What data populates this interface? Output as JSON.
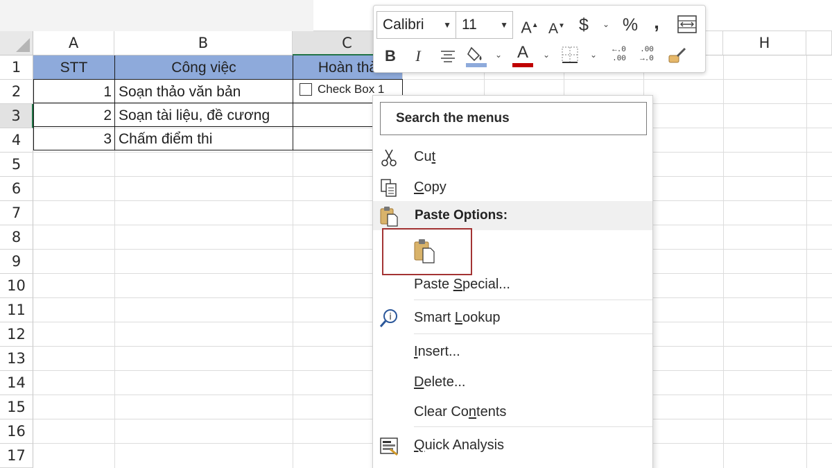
{
  "columns": [
    "A",
    "B",
    "C",
    "H"
  ],
  "rows": [
    "1",
    "2",
    "3",
    "4",
    "5",
    "6",
    "7",
    "8",
    "9",
    "10",
    "11",
    "12",
    "13",
    "14",
    "15",
    "16",
    "17"
  ],
  "table": {
    "headers": [
      "STT",
      "Công việc",
      "Hoàn thà"
    ],
    "rows": [
      {
        "stt": "1",
        "task": "Soạn thảo văn bản"
      },
      {
        "stt": "2",
        "task": "Soạn tài liệu, đề cương"
      },
      {
        "stt": "3",
        "task": "Chấm điểm thi"
      }
    ],
    "checkbox_label": "Check Box 1"
  },
  "toolbar": {
    "font_name": "Calibri",
    "font_size": "11",
    "grow_font": "A",
    "shrink_font": "A",
    "currency": "$",
    "percent": "%",
    "comma": ",",
    "bold": "B",
    "italic": "I",
    "font_color_letter": "A",
    "font_color": "#c00000",
    "fill_color": "#8eaadb",
    "increase_decimal": ".00",
    "decrease_decimal": ".0"
  },
  "context_menu": {
    "search_placeholder": "Search the menus",
    "cut": {
      "pre": "Cu",
      "key": "t",
      "post": ""
    },
    "copy": {
      "pre": "",
      "key": "C",
      "post": "opy"
    },
    "paste_options": "Paste Options:",
    "paste_special": {
      "pre": "Paste ",
      "key": "S",
      "post": "pecial..."
    },
    "smart_lookup": {
      "pre": "Smart ",
      "key": "L",
      "post": "ookup"
    },
    "insert": {
      "pre": "",
      "key": "I",
      "post": "nsert..."
    },
    "delete": {
      "pre": "",
      "key": "D",
      "post": "elete..."
    },
    "clear_contents": {
      "pre": "Clear Co",
      "key": "n",
      "post": "tents"
    },
    "quick_analysis": {
      "pre": "",
      "key": "Q",
      "post": "uick Analysis"
    },
    "highlight_color": "#a33333"
  }
}
